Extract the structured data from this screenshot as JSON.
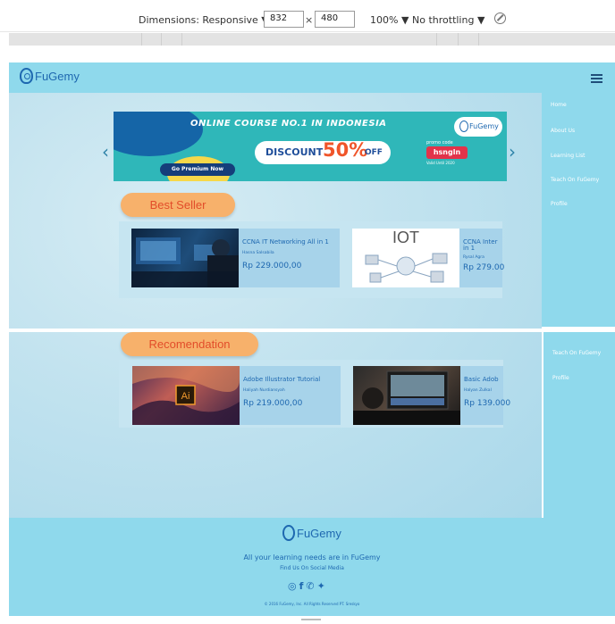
{
  "devtools": {
    "dimensions_label": "Dimensions: Responsive ▼",
    "width": "832",
    "separator": "×",
    "height": "480",
    "zoom": "100% ▼",
    "throttling": "No throttling ▼",
    "rotate_icon": "rotate-icon"
  },
  "header": {
    "logo_text": "FuGemy"
  },
  "nav": {
    "items": [
      "Home",
      "About Us",
      "Learning List",
      "Teach On FuGemy",
      "Profile"
    ],
    "overflow_items": [
      "Teach On FuGemy",
      "Profile"
    ]
  },
  "banner": {
    "headline": "ONLINE COURSE NO.1 IN INDONESIA",
    "discount_label": "DISCOUNT",
    "discount_value": "50%",
    "off_label": "OFF",
    "premium_button": "Go Premium Now",
    "promo_label": "promo code",
    "promo_code": "hsngln",
    "promo_valid": "Valid Until 2020",
    "logo_text": "FuGemy",
    "prev_arrow": "‹",
    "next_arrow": "›"
  },
  "best_seller": {
    "title": "Best Seller",
    "courses": [
      {
        "title": "CCNA IT Networking All in 1",
        "author": "Hasna Salsabila",
        "price": "Rp 229.000,00"
      },
      {
        "title": "CCNA Inter",
        "title_line2": "in 1",
        "author": "Rysal Agra",
        "price": "Rp 279.00",
        "image_text": "IOT"
      }
    ]
  },
  "recommendation": {
    "title": "Recomendation",
    "courses": [
      {
        "title": "Adobe Illustrator Tutorial",
        "author": "Haliyah Nurdiansyah",
        "price": "Rp 219.000,00",
        "image_text": "Ai"
      },
      {
        "title": "Basic Adob",
        "author": "Halyan Zulkal",
        "price": "Rp 139.000"
      }
    ]
  },
  "footer": {
    "logo_text": "FuGemy",
    "tagline": "All your learning needs are in FuGemy",
    "social_label": "Find Us On Social Media",
    "social_icons": [
      "instagram-icon",
      "facebook-icon",
      "whatsapp-icon",
      "twitter-icon"
    ],
    "copyright": "© 2016 FuGemy, Inc. All Rights Reserved PT. Sreskyo"
  }
}
